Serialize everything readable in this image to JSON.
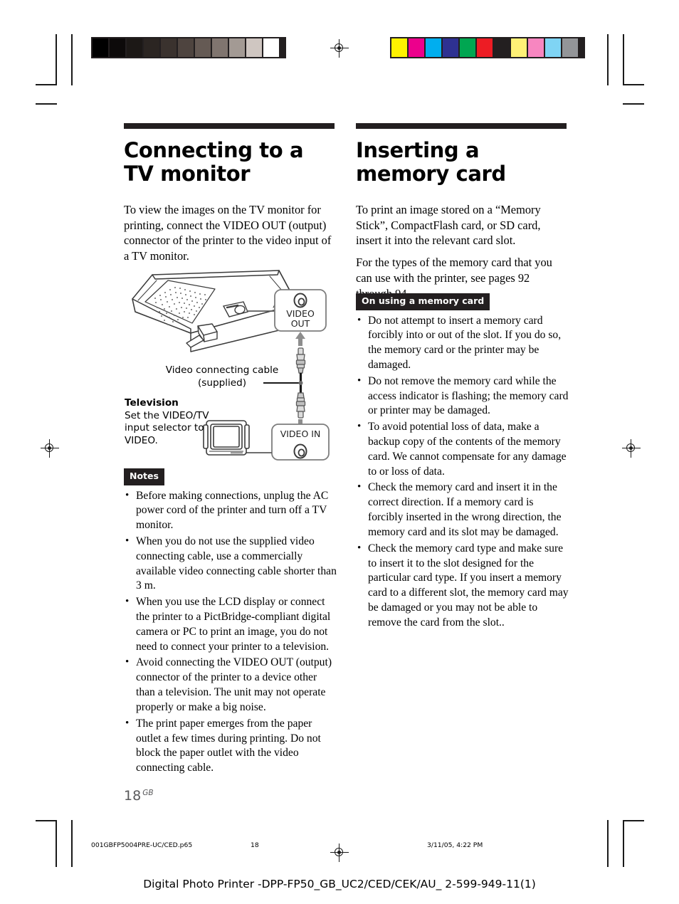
{
  "page": {
    "number": "18",
    "region_code": "GB"
  },
  "calibration": {
    "grayscale_label": "grayscale-step-wedge",
    "grayscale_patches": [
      "#000000",
      "#0d0a0a",
      "#1c1816",
      "#2b2522",
      "#3a322e",
      "#4e443f",
      "#655a54",
      "#80756f",
      "#a39a94",
      "#cfc6c1",
      "#ffffff"
    ],
    "color_label": "color-control-bar",
    "color_patches": [
      "#fff200",
      "#ec008c",
      "#00aeef",
      "#2e3192",
      "#00a651",
      "#ed1c24",
      "#231f20",
      "#fff176",
      "#f786c0",
      "#7fd4f4",
      "#939598"
    ]
  },
  "left_column": {
    "title": "Connecting to a TV monitor",
    "intro": "To view the images on the TV monitor for printing, connect the VIDEO OUT (output) connector of the printer to the video input of a TV monitor.",
    "figure": {
      "video_out_label_line1": "VIDEO",
      "video_out_label_line2": "OUT",
      "video_in_label": "VIDEO IN",
      "cable_caption_line1": "Video connecting cable",
      "cable_caption_line2": "(supplied)",
      "tv_title": "Television",
      "tv_instruction": "Set the VIDEO/TV input selector to VIDEO."
    },
    "notes_badge": "Notes",
    "notes": [
      "Before making connections, unplug the AC power cord of the printer and turn off a TV monitor.",
      "When you do not use the supplied video connecting cable, use a commercially available video connecting cable shorter than 3 m.",
      "When you use the LCD display or connect the printer to a PictBridge-compliant digital camera or PC to print an image, you do not need to connect your printer to a television.",
      "Avoid connecting the VIDEO OUT (output) connector of the printer to a device other than a television.  The unit may not operate properly or make a big noise.",
      "The print paper emerges from the paper outlet a few times during printing.  Do not block the paper outlet with the video connecting cable."
    ]
  },
  "right_column": {
    "title": "Inserting a memory card",
    "paragraphs": [
      "To print an image stored on a “Memory Stick”, CompactFlash card, or SD card, insert it into the relevant card slot.",
      "For the types of the memory card that you can use with the printer, see pages 92 through 94."
    ],
    "notes_badge": "On using a memory card",
    "notes": [
      "Do not attempt to insert a memory card forcibly into or out of the slot.  If you do so, the memory card or the printer may be damaged.",
      "Do not remove the memory card while the access indicator is flashing; the memory card or printer may be damaged.",
      "To avoid potential loss of data, make a backup copy of the contents of the memory card.  We cannot compensate for any damage to or loss of data.",
      "Check the memory card and insert it in the correct direction. If a memory card is forcibly inserted in the wrong direction, the memory card and its slot may be damaged.",
      "Check the memory card type and make sure to insert it to the slot designed for the particular card type. If you insert a memory card to a different slot, the memory card may be damaged or you may not be able to remove the card from the slot.."
    ]
  },
  "footer": {
    "proof_file": "001GBFP5004PRE-UC/CED.p65",
    "proof_page": "18",
    "proof_date": "3/11/05, 4:22 PM",
    "document_line": "Digital Photo Printer -DPP-FP50_GB_UC2/CED/CEK/AU_ 2-599-949-11(1)"
  }
}
